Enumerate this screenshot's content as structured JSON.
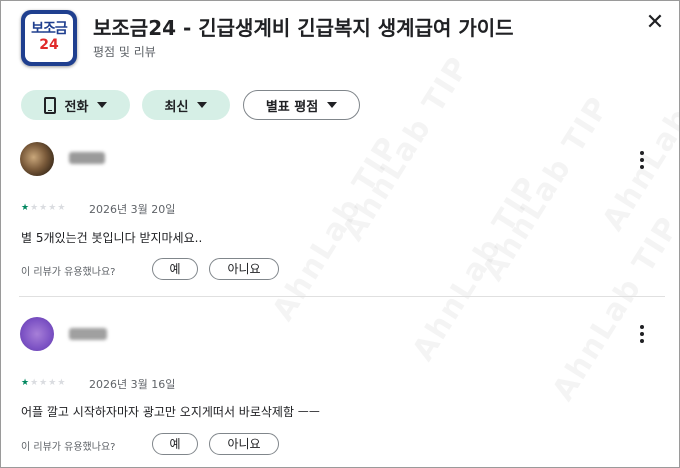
{
  "app": {
    "icon_line1": "보조금",
    "icon_line2": "24",
    "title": "보조금24 - 긴급생계비 긴급복지 생계급여 가이드",
    "subtitle": "평점 및 리뷰",
    "close_glyph": "✕"
  },
  "filters": {
    "device": "전화",
    "sort": "최신",
    "rating": "별표 평점"
  },
  "watermark": [
    "AhnLab TIP",
    "AhnLab TIP",
    "AhnLab TIP",
    "AhnLab TIP",
    "AhnLab TIP",
    "AhnLab TIP"
  ],
  "reviews": [
    {
      "rating": 1,
      "max_rating": 5,
      "date": "2026년 3월 20일",
      "text": "별 5개있는건 봇입니다 받지마세요..",
      "helpful_prompt": "이 리뷰가 유용했나요?",
      "yes": "예",
      "no": "아니요"
    },
    {
      "rating": 1,
      "max_rating": 5,
      "date": "2026년 3월 16일",
      "text": "어플 깔고 시작하자마자 광고만 오지게떠서 바로삭제함 ㅡㅡ",
      "helpful_prompt": "이 리뷰가 유용했나요?",
      "yes": "예",
      "no": "아니요"
    }
  ],
  "colors": {
    "accent_chip": "#d6efe6",
    "star_on": "#01875f",
    "icon_blue": "#1f3f8f",
    "icon_red": "#e02a2a"
  }
}
